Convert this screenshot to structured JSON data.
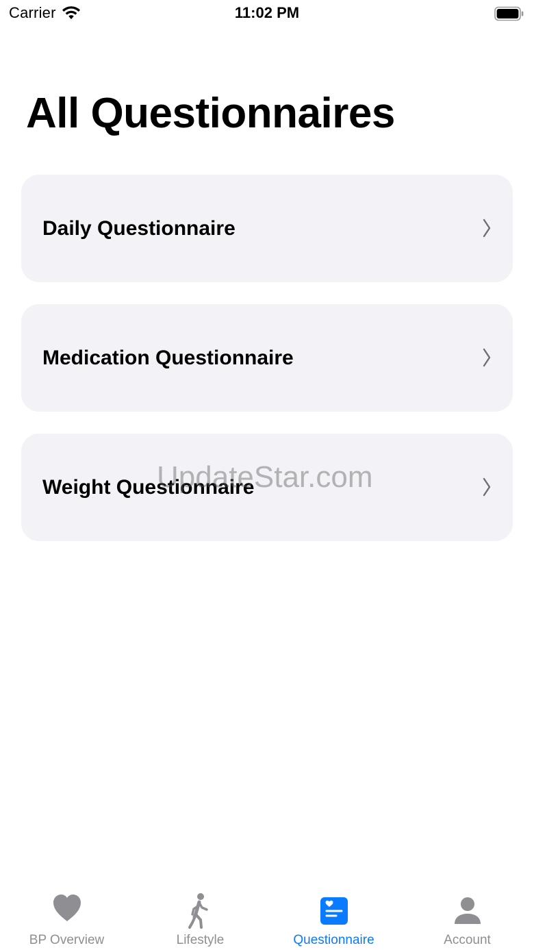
{
  "status_bar": {
    "carrier": "Carrier",
    "time": "11:02 PM",
    "icons": [
      "wifi-icon",
      "battery-icon"
    ]
  },
  "page": {
    "title": "All Questionnaires"
  },
  "questionnaires": [
    {
      "label": "Daily Questionnaire",
      "icon": "chevron-right-icon"
    },
    {
      "label": "Medication Questionnaire",
      "icon": "chevron-right-icon"
    },
    {
      "label": "Weight Questionnaire",
      "icon": "chevron-right-icon"
    }
  ],
  "watermark": {
    "text": "UpdateStar.com"
  },
  "tab_bar": {
    "active_tab": "Questionnaire",
    "active_color": "#0a7aff",
    "inactive_color": "#8e8e93",
    "tabs": [
      {
        "label": "BP Overview",
        "icon": "heart-icon"
      },
      {
        "label": "Lifestyle",
        "icon": "walking-figure-icon"
      },
      {
        "label": "Questionnaire",
        "icon": "questionnaire-doc-icon"
      },
      {
        "label": "Account",
        "icon": "person-icon"
      }
    ]
  },
  "colors": {
    "card_background": "#f2f2f7",
    "background": "#ffffff",
    "text": "#000000"
  }
}
